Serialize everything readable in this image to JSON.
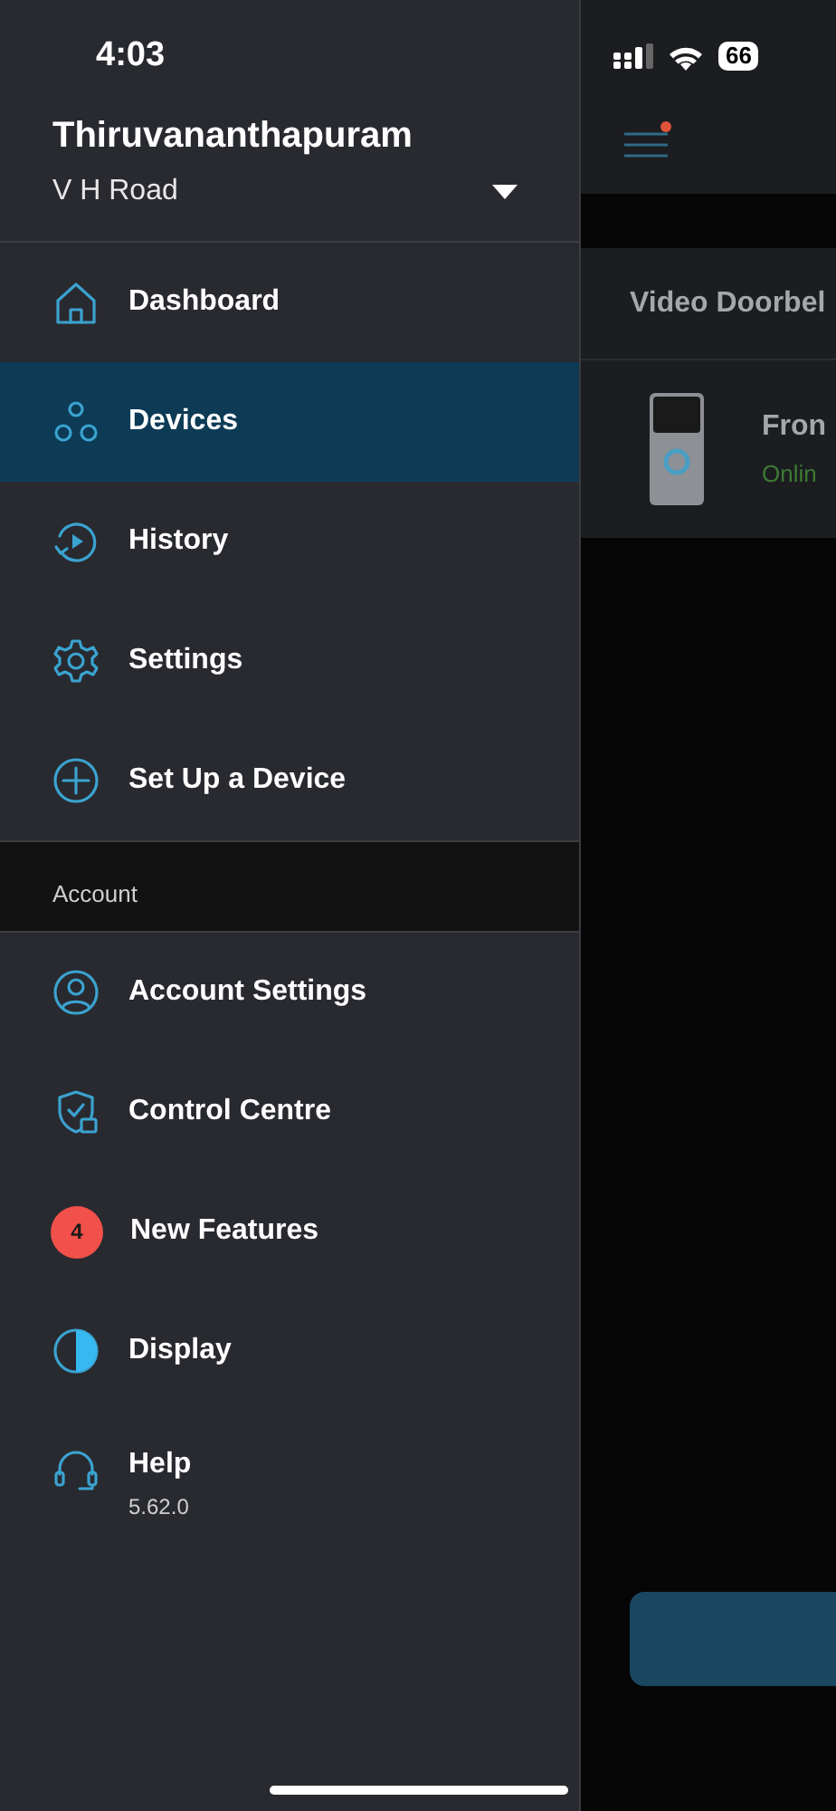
{
  "status_bar": {
    "time": "4:03",
    "battery": "66"
  },
  "location": {
    "name": "Thiruvananthapuram",
    "address": "V H Road"
  },
  "nav_items": [
    {
      "kind": "icon",
      "label": "Dashboard",
      "selected": false
    },
    {
      "kind": "icon",
      "label": "Devices",
      "selected": true
    },
    {
      "kind": "icon",
      "label": "History",
      "selected": false
    },
    {
      "kind": "icon",
      "label": "Settings",
      "selected": false
    },
    {
      "kind": "icon",
      "label": "Set Up a Device",
      "selected": false
    }
  ],
  "account_section": {
    "title": "Account",
    "items": [
      {
        "kind": "icon",
        "label": "Account Settings"
      },
      {
        "kind": "icon",
        "label": "Control Centre"
      },
      {
        "kind": "badge",
        "label": "New Features",
        "badge": "4"
      },
      {
        "kind": "icon",
        "label": "Display"
      },
      {
        "kind": "icon",
        "label": "Help",
        "subtitle": "5.62.0"
      }
    ]
  },
  "background_screen": {
    "tab": "Video Doorbel",
    "device": {
      "name": "Fron",
      "status": "Onlin"
    }
  }
}
